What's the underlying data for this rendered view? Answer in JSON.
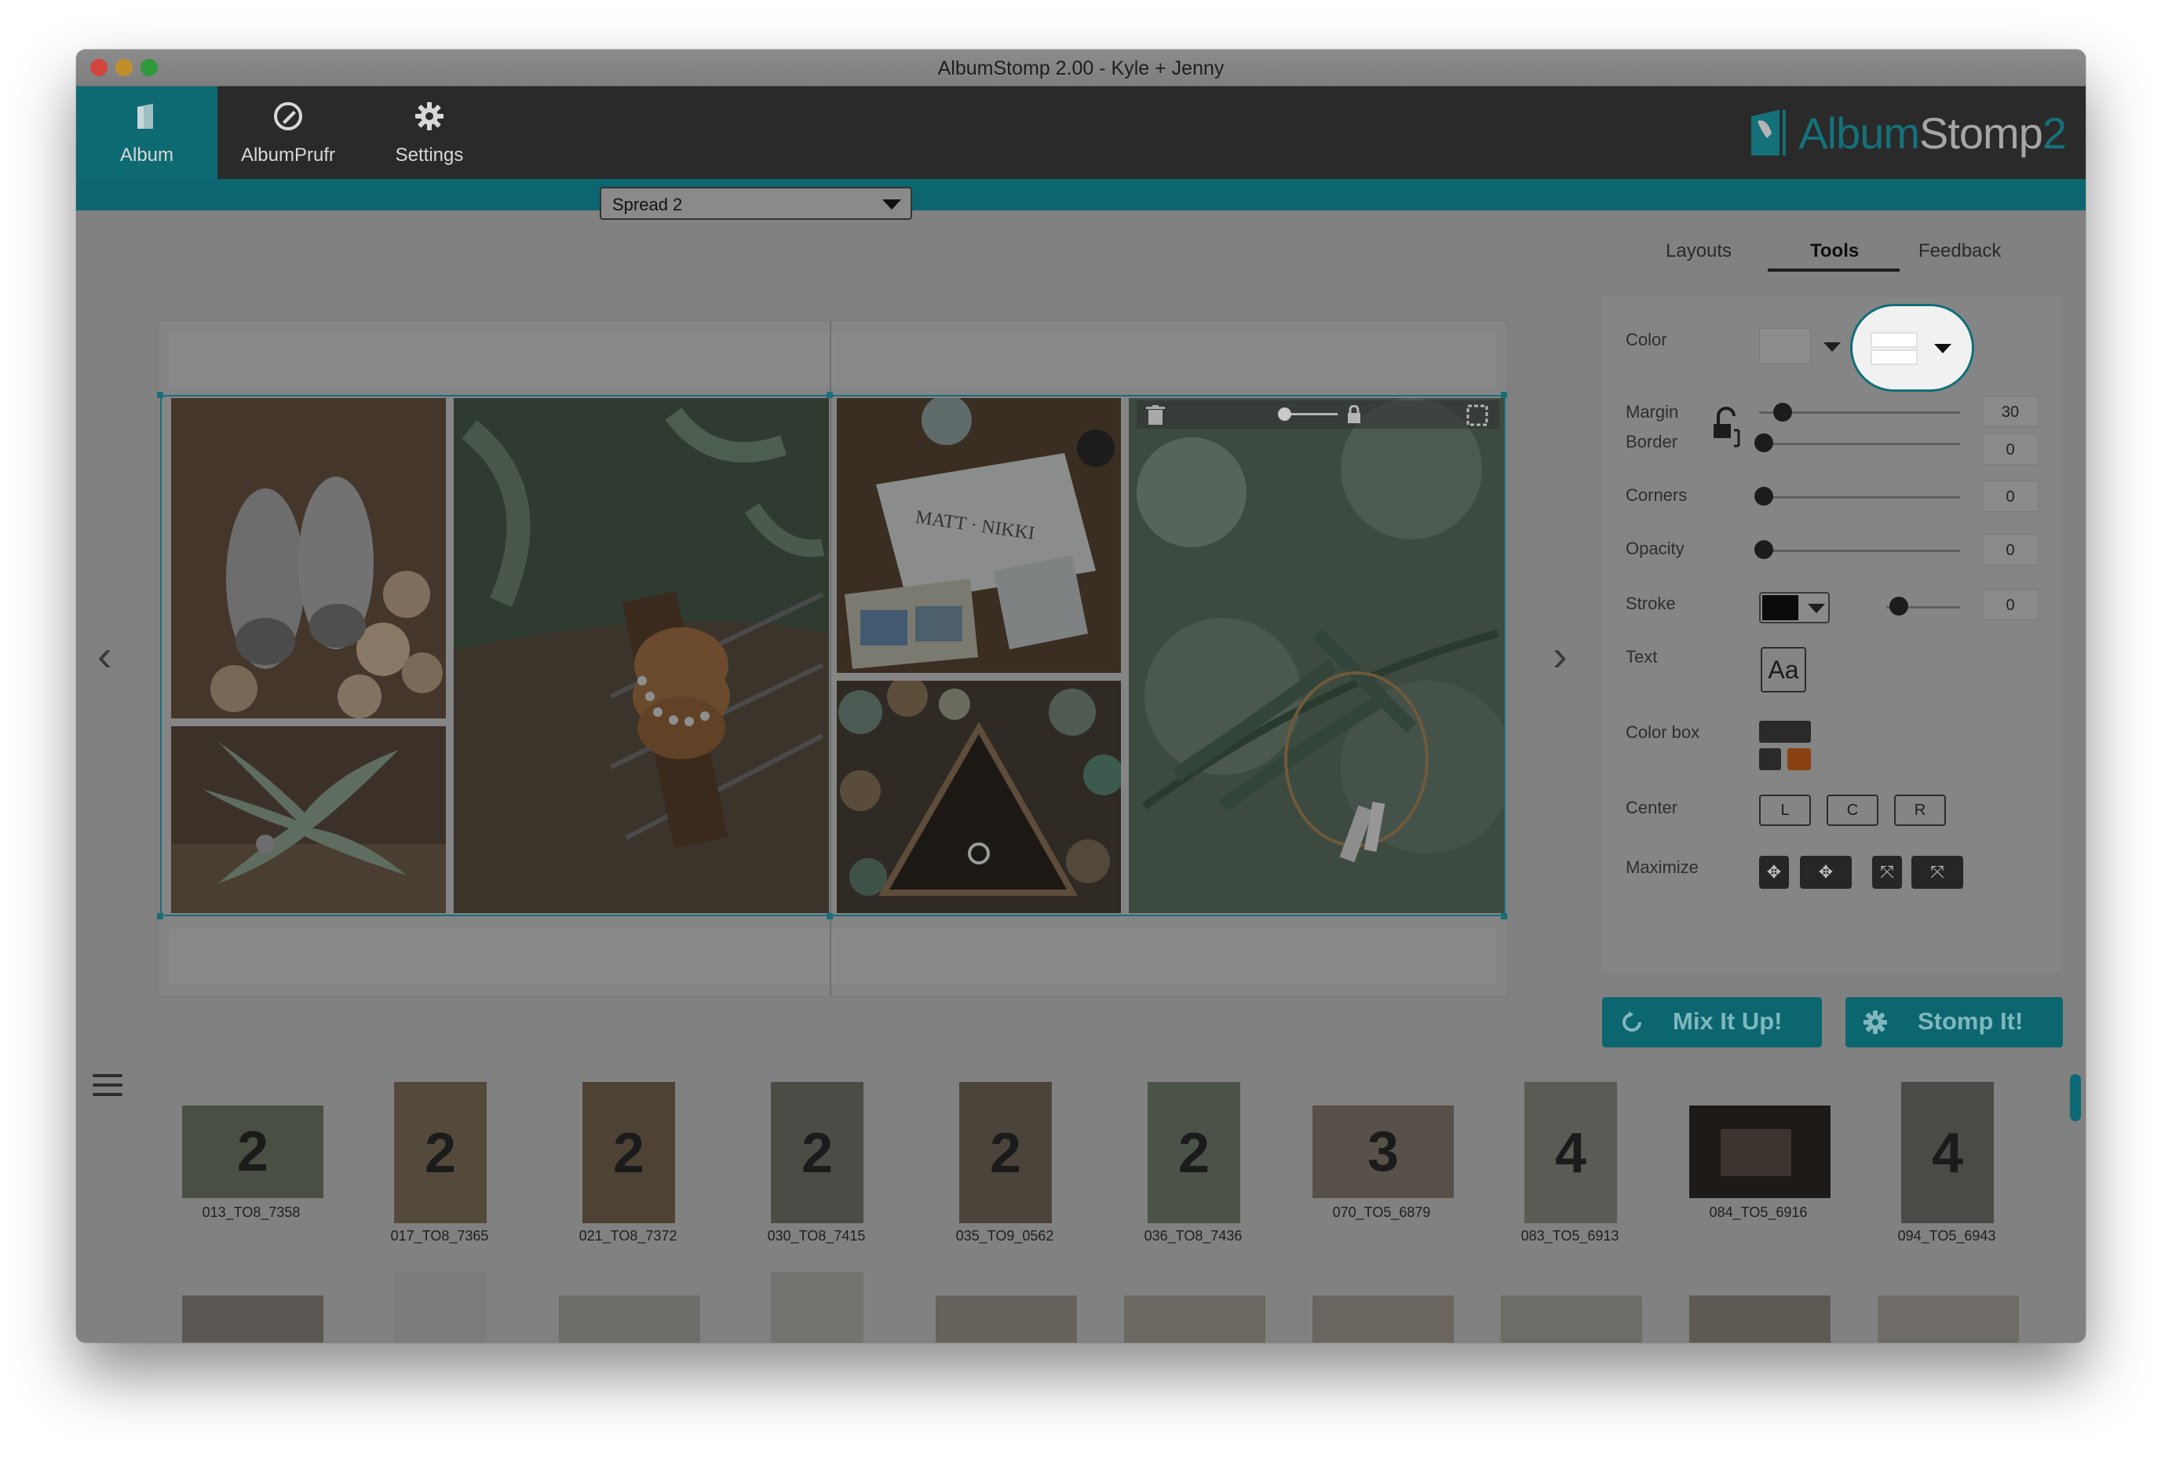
{
  "window": {
    "title": "AlbumStomp 2.00 - Kyle + Jenny"
  },
  "toolbar": {
    "items": [
      {
        "label": "Album",
        "icon": "album-icon",
        "active": true
      },
      {
        "label": "AlbumPrufr",
        "icon": "albumprufr-icon",
        "active": false
      },
      {
        "label": "Settings",
        "icon": "gear-icon",
        "active": false
      }
    ],
    "brand": {
      "part1": "Album",
      "part2": "Stomp",
      "part3": "2"
    }
  },
  "spread": {
    "selected": "Spread 2"
  },
  "right_tabs": {
    "layouts": "Layouts",
    "tools": "Tools",
    "feedback": "Feedback",
    "active": "Tools"
  },
  "tools": {
    "color_label": "Color",
    "margin_label": "Margin",
    "margin_value": "30",
    "border_label": "Border",
    "border_value": "0",
    "corners_label": "Corners",
    "corners_value": "0",
    "opacity_label": "Opacity",
    "opacity_value": "0",
    "stroke_label": "Stroke",
    "stroke_value": "0",
    "text_label": "Text",
    "text_button": "Aa",
    "colorbox_label": "Color box",
    "center_label": "Center",
    "center_left": "L",
    "center_center": "C",
    "center_right": "R",
    "maximize_label": "Maximize"
  },
  "actions": {
    "mix": "Mix It Up!",
    "stomp": "Stomp It!"
  },
  "thumbnails": [
    {
      "count": "2",
      "name": "013_TO8_7358",
      "orient": "landscape"
    },
    {
      "count": "2",
      "name": "017_TO8_7365",
      "orient": "portrait"
    },
    {
      "count": "2",
      "name": "021_TO8_7372",
      "orient": "portrait"
    },
    {
      "count": "2",
      "name": "030_TO8_7415",
      "orient": "portrait"
    },
    {
      "count": "2",
      "name": "035_TO9_0562",
      "orient": "portrait"
    },
    {
      "count": "2",
      "name": "036_TO8_7436",
      "orient": "portrait"
    },
    {
      "count": "3",
      "name": "070_TO5_6879",
      "orient": "landscape"
    },
    {
      "count": "4",
      "name": "083_TO5_6913",
      "orient": "portrait"
    },
    {
      "count": "",
      "name": "084_TO5_6916",
      "orient": "landscape"
    },
    {
      "count": "4",
      "name": "094_TO5_6943",
      "orient": "portrait"
    }
  ],
  "colors": {
    "accent": "#0c6670",
    "toolbar": "#2a2a2a",
    "overlay": "#818181"
  }
}
